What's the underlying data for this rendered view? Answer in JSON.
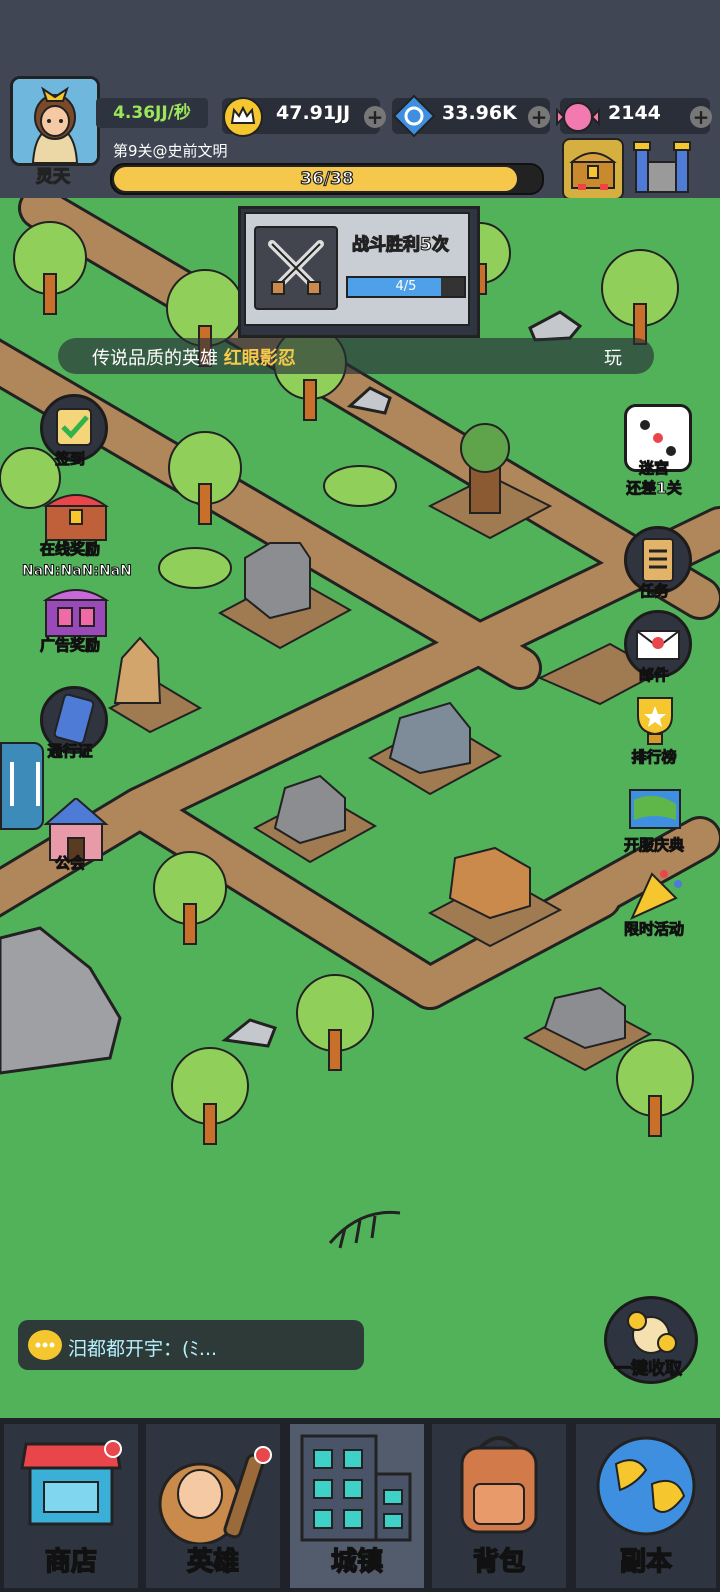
{
  "player": {
    "name": "灵天",
    "rate": "4.36JJ/秒",
    "level_label": "第9关@史前文明",
    "progress_text": "36/38",
    "progress_fraction": 0.947
  },
  "resources": [
    {
      "name": "crown",
      "value": "47.91JJ"
    },
    {
      "name": "gem",
      "value": "33.96K"
    },
    {
      "name": "candy",
      "value": "2144"
    }
  ],
  "quest": {
    "title": "战斗胜利5次",
    "progress_text": "4/5",
    "progress_fraction": 0.8
  },
  "marquee": {
    "prefix": "传说品质的英雄",
    "hero": "红眼影忍",
    "tail": "玩"
  },
  "left_buttons": [
    {
      "label": "签到"
    },
    {
      "label": "在线奖励"
    },
    {
      "label": "NaN:NaN:NaN"
    },
    {
      "label": "广告奖励"
    },
    {
      "label": "通行证"
    },
    {
      "label": "公会"
    }
  ],
  "right_buttons": [
    {
      "label": "迷宫\n还差1关"
    },
    {
      "label": "任务"
    },
    {
      "label": "邮件"
    },
    {
      "label": "排行榜"
    },
    {
      "label": "开服庆典"
    },
    {
      "label": "限时活动"
    }
  ],
  "chat": {
    "text": "汨都都开宇：(ﾐ..."
  },
  "collect_label": "一键收取",
  "nav_tabs": [
    {
      "label": "商店"
    },
    {
      "label": "英雄"
    },
    {
      "label": "城镇"
    },
    {
      "label": "背包"
    },
    {
      "label": "副本"
    }
  ],
  "colors": {
    "map_green": "#52b25a",
    "path_brown": "#b0875a",
    "progress_yellow": "#f5c84b",
    "quest_blue": "#4ea0e8",
    "hero_gold": "#f6c94b"
  }
}
